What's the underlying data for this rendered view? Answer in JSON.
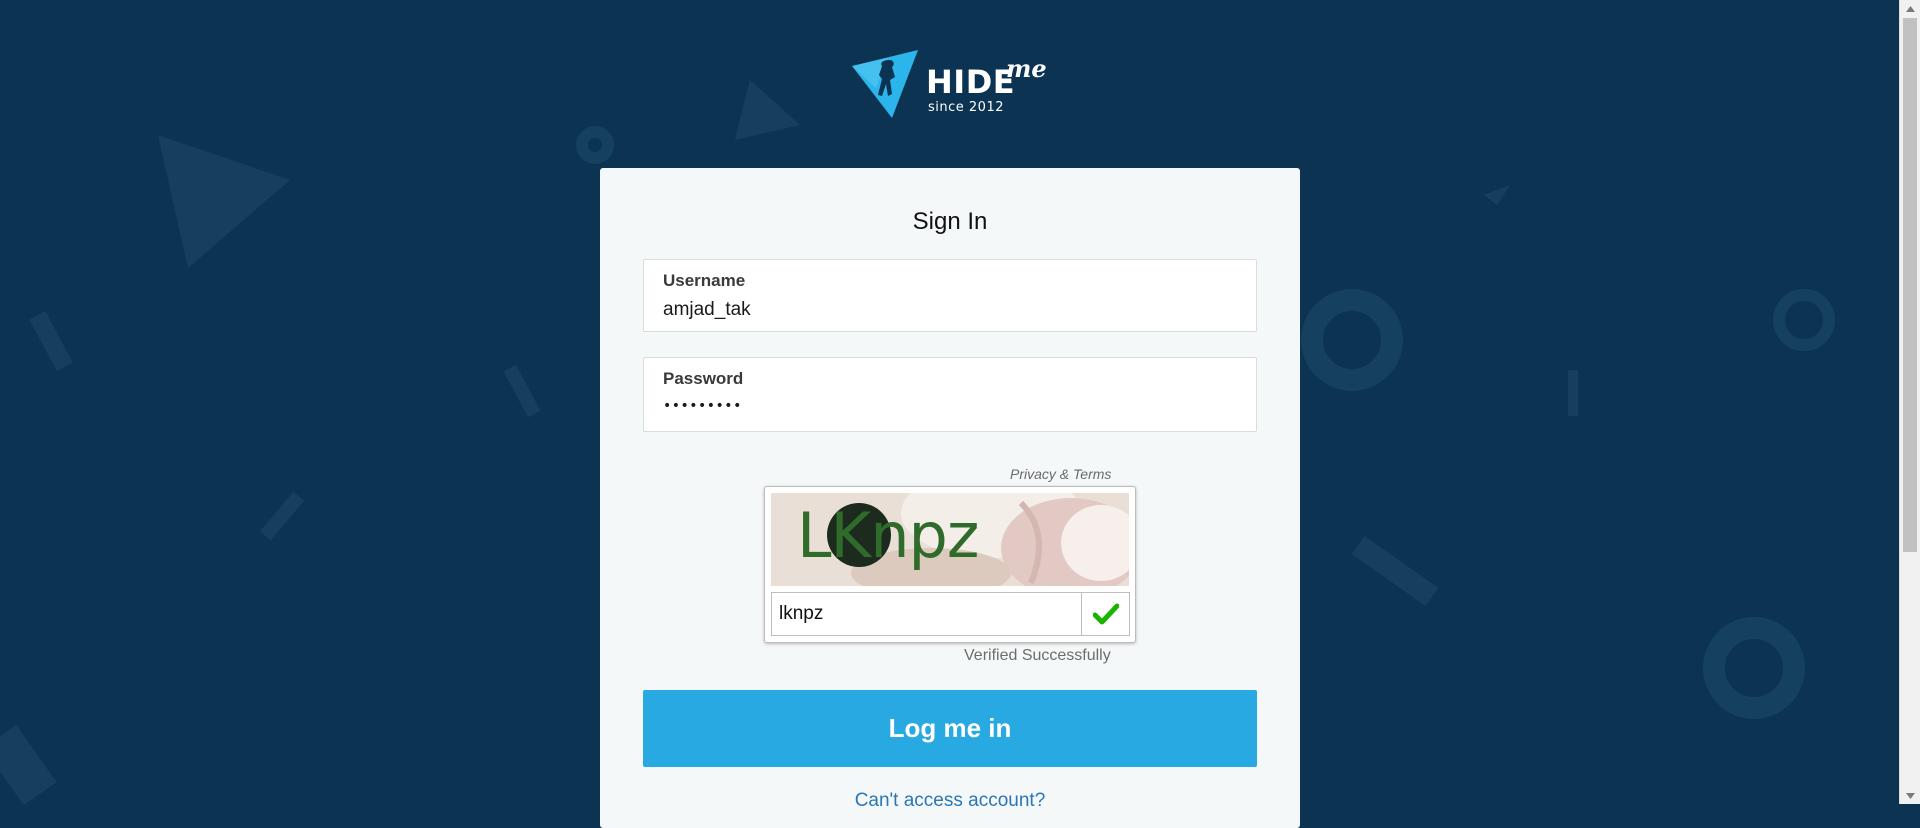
{
  "logo": {
    "wordmark": "HIDE",
    "suffix": "me",
    "since": "since 2012"
  },
  "card": {
    "title": "Sign In"
  },
  "username": {
    "label": "Username",
    "value": "amjad_tak"
  },
  "password": {
    "label": "Password",
    "value": "•••••••••"
  },
  "captcha": {
    "privacy_link": "Privacy & Terms",
    "image_text": "LKnpz",
    "input_value": "lknpz",
    "status": "Verified Successfully"
  },
  "login_button": {
    "label": "Log me in"
  },
  "cant_access_link": "Can't access account?",
  "colors": {
    "background": "#0c3352",
    "accent": "#29a9e1",
    "link": "#2b76b6",
    "check": "#1bb500"
  }
}
